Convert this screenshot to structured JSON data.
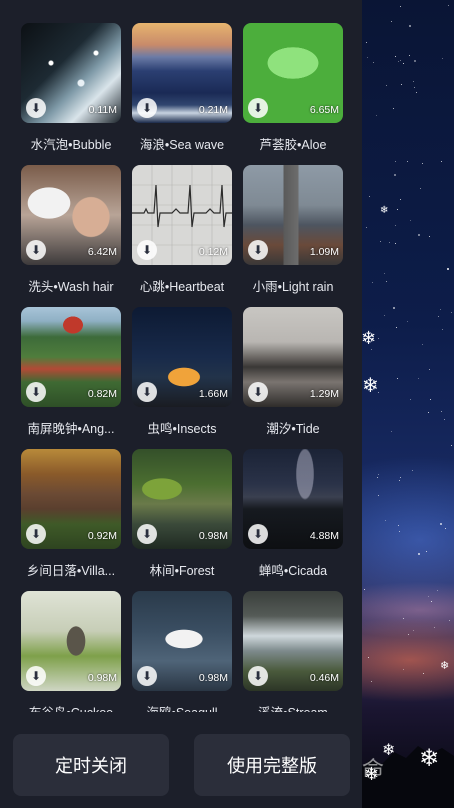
{
  "sounds": [
    {
      "name": "水汽泡•Bubble",
      "size": "0.11M",
      "icon": "download-icon"
    },
    {
      "name": "海浪•Sea wave",
      "size": "0.21M",
      "icon": "download-icon"
    },
    {
      "name": "芦荟胶•Aloe",
      "size": "6.65M",
      "icon": "download-icon"
    },
    {
      "name": "洗头•Wash hair",
      "size": "6.42M",
      "icon": "download-icon"
    },
    {
      "name": "心跳•Heartbeat",
      "size": "0.12M",
      "icon": "download-icon"
    },
    {
      "name": "小雨•Light rain",
      "size": "1.09M",
      "icon": "download-icon"
    },
    {
      "name": "南屏晚钟•Ang...",
      "size": "0.82M",
      "icon": "download-icon"
    },
    {
      "name": "虫鸣•Insects",
      "size": "1.66M",
      "icon": "download-icon"
    },
    {
      "name": "潮汐•Tide",
      "size": "1.29M",
      "icon": "download-icon"
    },
    {
      "name": "乡间日落•Villa...",
      "size": "0.92M",
      "icon": "download-icon"
    },
    {
      "name": "林间•Forest",
      "size": "0.98M",
      "icon": "download-icon"
    },
    {
      "name": "蝉鸣•Cicada",
      "size": "4.88M",
      "icon": "download-icon"
    },
    {
      "name": "布谷鸟•Cuckoo",
      "size": "0.98M",
      "icon": "download-icon"
    },
    {
      "name": "海鸥•Seagull",
      "size": "0.98M",
      "icon": "download-icon"
    },
    {
      "name": "溪流•Stream",
      "size": "0.46M",
      "icon": "download-icon"
    }
  ],
  "buttons": {
    "timer_close": "定时关闭",
    "full_version": "使用完整版"
  },
  "background": {
    "watermark": "命"
  },
  "colors": {
    "panel": "#1c1f2a",
    "button": "#2b2e3a",
    "text": "#e6e8ee"
  }
}
